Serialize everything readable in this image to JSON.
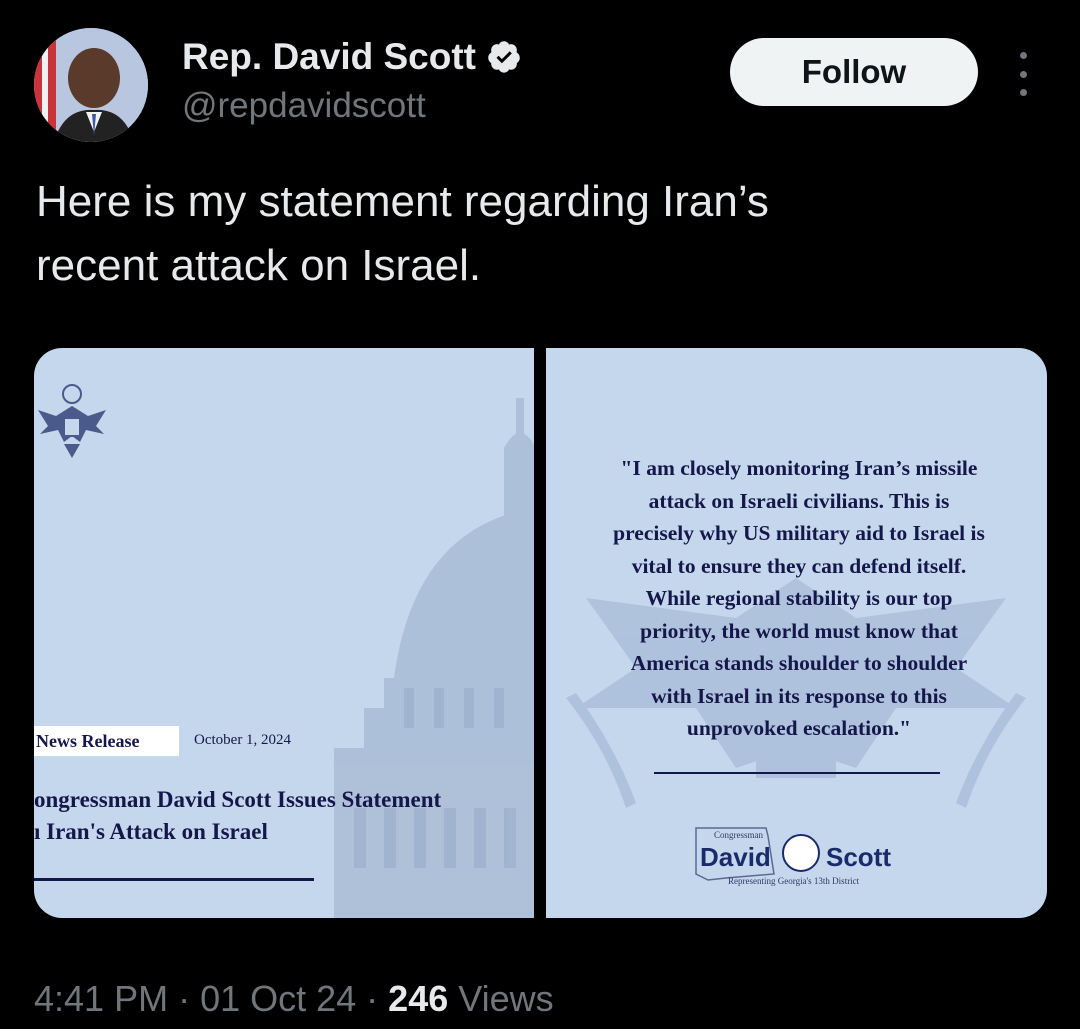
{
  "author": {
    "name": "Rep. David Scott",
    "handle": "@repdavidscott",
    "verified": true
  },
  "follow_label": "Follow",
  "tweet": {
    "text_line1": "Here is my statement regarding Iran’s",
    "text_line2": "recent attack on Israel."
  },
  "media": {
    "left": {
      "tag": "News Release",
      "date": "October 1, 2024",
      "title_line1": "ongressman David Scott Issues Statement",
      "title_line2": "ı Iran's Attack on Israel"
    },
    "right": {
      "quote_lines": [
        "\"I am closely monitoring Iran’s missile",
        "attack on Israeli civilians. This is",
        "precisely why US military aid to Israel is",
        "vital to ensure they can defend itself.",
        "While regional stability is our top",
        "priority, the world must know that",
        "America stands shoulder to shoulder",
        "with Israel in its response to this",
        "unprovoked escalation.\""
      ],
      "logo_top": "Congressman",
      "logo_first": "David",
      "logo_last": "Scott",
      "logo_tagline": "Representing Georgia's 13th District"
    }
  },
  "meta": {
    "time": "4:41 PM",
    "separator": "·",
    "date": "01 Oct 24",
    "views_count": "246",
    "views_label": "Views"
  },
  "colors": {
    "background": "#000000",
    "text": "#e7e9ea",
    "muted": "#71767b",
    "verified": "#1d9bf0",
    "panel": "#c5d7ec",
    "navy": "#15174a"
  },
  "icons": [
    "verified-badge-icon",
    "more-options-icon",
    "eagle-seal-icon",
    "capitol-dome-icon"
  ]
}
